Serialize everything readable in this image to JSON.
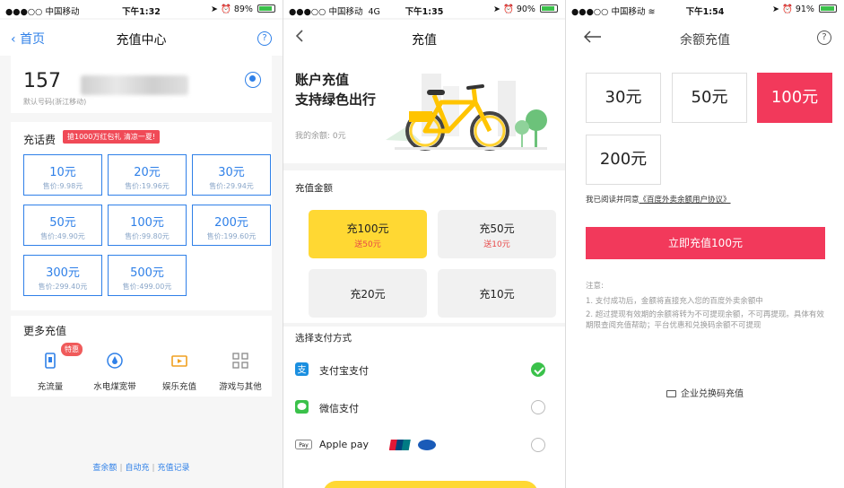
{
  "screen1": {
    "status": {
      "carrier": "●●●○○ 中国移动",
      "time": "下午1:32",
      "battery": "89%",
      "battery_level": 0.89
    },
    "nav": {
      "back": "首页",
      "title": "充值中心",
      "help": "?"
    },
    "phone_prefix": "157",
    "default_number_note": "默认号码(浙江移动)",
    "recharge_title": "充话费",
    "promo": "搶1000万红包礼 清凉一夏!",
    "options": [
      {
        "amount": "10元",
        "price": "售价:9.98元"
      },
      {
        "amount": "20元",
        "price": "售价:19.96元"
      },
      {
        "amount": "30元",
        "price": "售价:29.94元"
      },
      {
        "amount": "50元",
        "price": "售价:49.90元"
      },
      {
        "amount": "100元",
        "price": "售价:99.80元"
      },
      {
        "amount": "200元",
        "price": "售价:199.60元"
      },
      {
        "amount": "300元",
        "price": "售价:299.40元"
      },
      {
        "amount": "500元",
        "price": "售价:499.00元"
      }
    ],
    "more_title": "更多充值",
    "more_badge": "特惠",
    "more_items": [
      "充流量",
      "水电煤宽带",
      "娱乐充值",
      "游戏与其他"
    ],
    "links": [
      "查余额",
      "自动充",
      "充值记录"
    ],
    "accent": "#2f80e8"
  },
  "screen2": {
    "status": {
      "carrier": "●●●○○ 中国移动",
      "network": "4G",
      "time": "下午1:35",
      "battery": "90%",
      "battery_level": 0.9
    },
    "nav": {
      "title": "充值"
    },
    "headline1": "账户充值",
    "headline2": "支持绿色出行",
    "balance": "我的余额: 0元",
    "amount_title": "充值金额",
    "options": [
      {
        "label": "充100元",
        "bonus": "送50元",
        "selected": true
      },
      {
        "label": "充50元",
        "bonus": "送10元",
        "selected": false
      },
      {
        "label": "充20元",
        "bonus": "",
        "selected": false
      },
      {
        "label": "充10元",
        "bonus": "",
        "selected": false
      }
    ],
    "pay_title": "选择支付方式",
    "pay_methods": [
      {
        "label": "支付宝支付",
        "icon": "alipay-icon",
        "selected": true
      },
      {
        "label": "微信支付",
        "icon": "wechat-icon",
        "selected": false
      },
      {
        "label": "Apple pay",
        "icon": "applepay-icon",
        "selected": false
      }
    ],
    "applepay_badge": "Pay",
    "accent": "#ffd833"
  },
  "screen3": {
    "status": {
      "carrier": "●●●○○ 中国移动",
      "time": "下午1:54",
      "battery": "91%",
      "battery_level": 0.91
    },
    "nav": {
      "title": "余额充值",
      "help": "?"
    },
    "amounts": [
      {
        "label": "30元",
        "selected": false
      },
      {
        "label": "50元",
        "selected": false
      },
      {
        "label": "100元",
        "selected": true
      },
      {
        "label": "200元",
        "selected": false
      }
    ],
    "agree_prefix": "我已阅读并同意",
    "agree_link": "《百度外卖余额用户协议》",
    "cta": "立即充值100元",
    "notes_title": "注意:",
    "notes": [
      "1. 支付成功后，金额将直接充入您的百度外卖余额中",
      "2. 超过提现有效期的余额将转为不可提现余额，不可再提现。具体有效期限查阅充值帮助；平台优惠和兑换码余额不可提现"
    ],
    "enterprise": "企业兑换码充值",
    "accent": "#f2395b"
  }
}
